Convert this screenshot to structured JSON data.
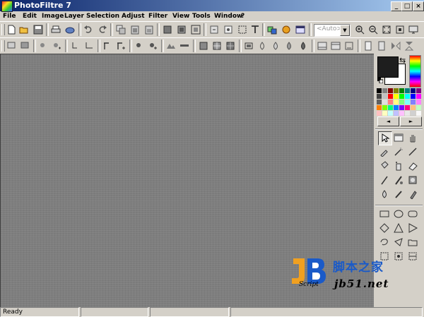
{
  "window": {
    "title": "PhotoFiltre 7",
    "controls": {
      "minimize": "_",
      "maximize": "□",
      "close": "×"
    }
  },
  "menubar": {
    "items": [
      {
        "label": "File",
        "icon": "file-menu"
      },
      {
        "label": "Edit",
        "icon": "edit-menu"
      },
      {
        "label": "Image",
        "icon": "image-menu"
      },
      {
        "label": "Layer",
        "icon": "layer-menu"
      },
      {
        "label": "Selection",
        "icon": "selection-menu"
      },
      {
        "label": "Adjust",
        "icon": "adjust-menu"
      },
      {
        "label": "Filter",
        "icon": "filter-menu"
      },
      {
        "label": "View",
        "icon": "view-menu"
      },
      {
        "label": "Tools",
        "icon": "tools-menu"
      },
      {
        "label": "Window",
        "icon": "window-menu"
      },
      {
        "label": "?",
        "icon": "help-menu"
      }
    ]
  },
  "toolbar": {
    "zoom_value": "<Auto>",
    "buttons1": [
      "new-icon",
      "open-icon",
      "save-icon",
      "print-icon",
      "scan-icon",
      "undo-icon",
      "redo-icon",
      "copy-icon",
      "paste-icon",
      "paste-new-icon",
      "mask-icon",
      "image-size-icon",
      "canvas-size-icon",
      "rotate-icon",
      "layer-icon",
      "selection-icon",
      "text-icon",
      "transfer-icon",
      "automation-icon",
      "slideshow-icon",
      "zoom-in-icon",
      "zoom-out-icon",
      "fit-icon",
      "actual-size-icon",
      "fullscreen-icon"
    ],
    "buttons2": [
      "auto-levels-icon",
      "auto-contrast-icon",
      "brightness-down-icon",
      "brightness-up-icon",
      "contrast-down-icon",
      "contrast-up-icon",
      "gamma-down-icon",
      "gamma-up-icon",
      "saturation-down-icon",
      "saturation-up-icon",
      "grayscale-icon",
      "sepia-icon",
      "emboss-icon",
      "blur-icon",
      "sharpen-icon",
      "diffuse-icon",
      "cloud-icon",
      "soften-icon",
      "drop-icon",
      "drops-icon",
      "flip-h-icon",
      "flip-v-icon",
      "effect-icon",
      "rotate-90-icon",
      "rotate-270-icon"
    ]
  },
  "colors": {
    "foreground": "#1e1e1e",
    "background": "#ffffff",
    "palette": [
      "#000000",
      "#808080",
      "#800000",
      "#808000",
      "#008000",
      "#008080",
      "#000080",
      "#800080",
      "#404040",
      "#c0c0c0",
      "#ff0000",
      "#ffff00",
      "#00ff00",
      "#00ffff",
      "#0000ff",
      "#ff00ff",
      "#606060",
      "#e0e0e0",
      "#ff8080",
      "#ffff80",
      "#80ff80",
      "#80ffff",
      "#8080ff",
      "#ff80ff",
      "#ff8000",
      "#80ff00",
      "#00ff80",
      "#0080ff",
      "#8000ff",
      "#ff0080",
      "#ffc080",
      "#c0ffc0",
      "#ffc0c0",
      "#ffffc0",
      "#c0ffff",
      "#c0c0ff",
      "#ffc0ff",
      "#e8e8e8",
      "#d0d0d0",
      "#f8f8f8"
    ]
  },
  "tools": {
    "main": [
      "select-icon",
      "magic-wand-icon",
      "hand-icon",
      "eyedropper-icon",
      "wand-icon",
      "line-icon",
      "bucket-icon",
      "spray-icon",
      "eraser-icon",
      "brush-icon",
      "advanced-brush-icon",
      "stamp-icon",
      "blur-tool-icon",
      "finger-icon",
      "clone-icon"
    ],
    "shapes": [
      "rectangle-icon",
      "ellipse-icon",
      "rounded-rect-icon",
      "diamond-icon",
      "triangle-icon",
      "play-triangle-icon",
      "lasso-icon",
      "polygon-icon",
      "folder-icon",
      "grid1-icon",
      "grid2-icon",
      "grid3-icon"
    ]
  },
  "status": {
    "text": "Ready"
  },
  "watermark": {
    "site_cn": "脚本之家",
    "site_url": "jb51.net",
    "script_label": "Script",
    "logo_text": "JB"
  }
}
